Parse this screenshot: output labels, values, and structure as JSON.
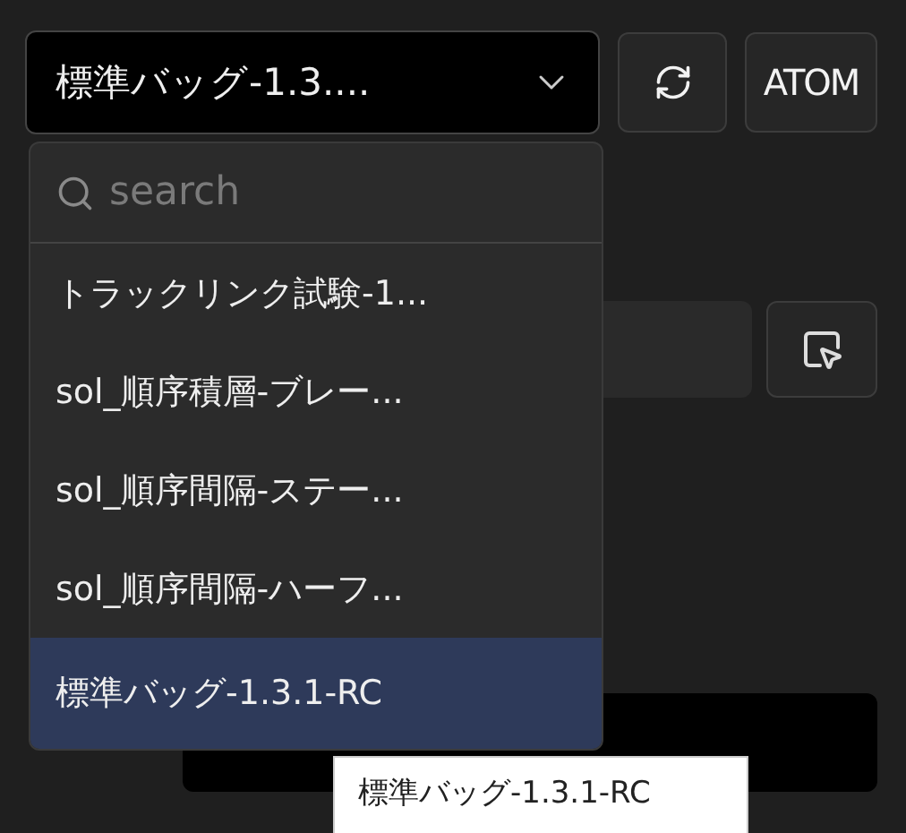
{
  "selector": {
    "value": "標準バッグ-1.3....",
    "expanded": true
  },
  "toolbar": [
    {
      "kind": "refresh"
    },
    {
      "kind": "text",
      "label": "ATOM"
    }
  ],
  "dropdown": {
    "search": {
      "placeholder": "search"
    },
    "options": [
      {
        "label": "トラックリンク試験-1...",
        "selected": false
      },
      {
        "label": "sol_順序積層-ブレー...",
        "selected": false
      },
      {
        "label": "sol_順序間隔-ステー...",
        "selected": false
      },
      {
        "label": "sol_順序間隔-ハーフ...",
        "selected": false
      },
      {
        "label": "標準バッグ-1.3.1-RC",
        "selected": true
      }
    ]
  },
  "tooltip": {
    "text": "標準バッグ-1.3.1-RC"
  }
}
